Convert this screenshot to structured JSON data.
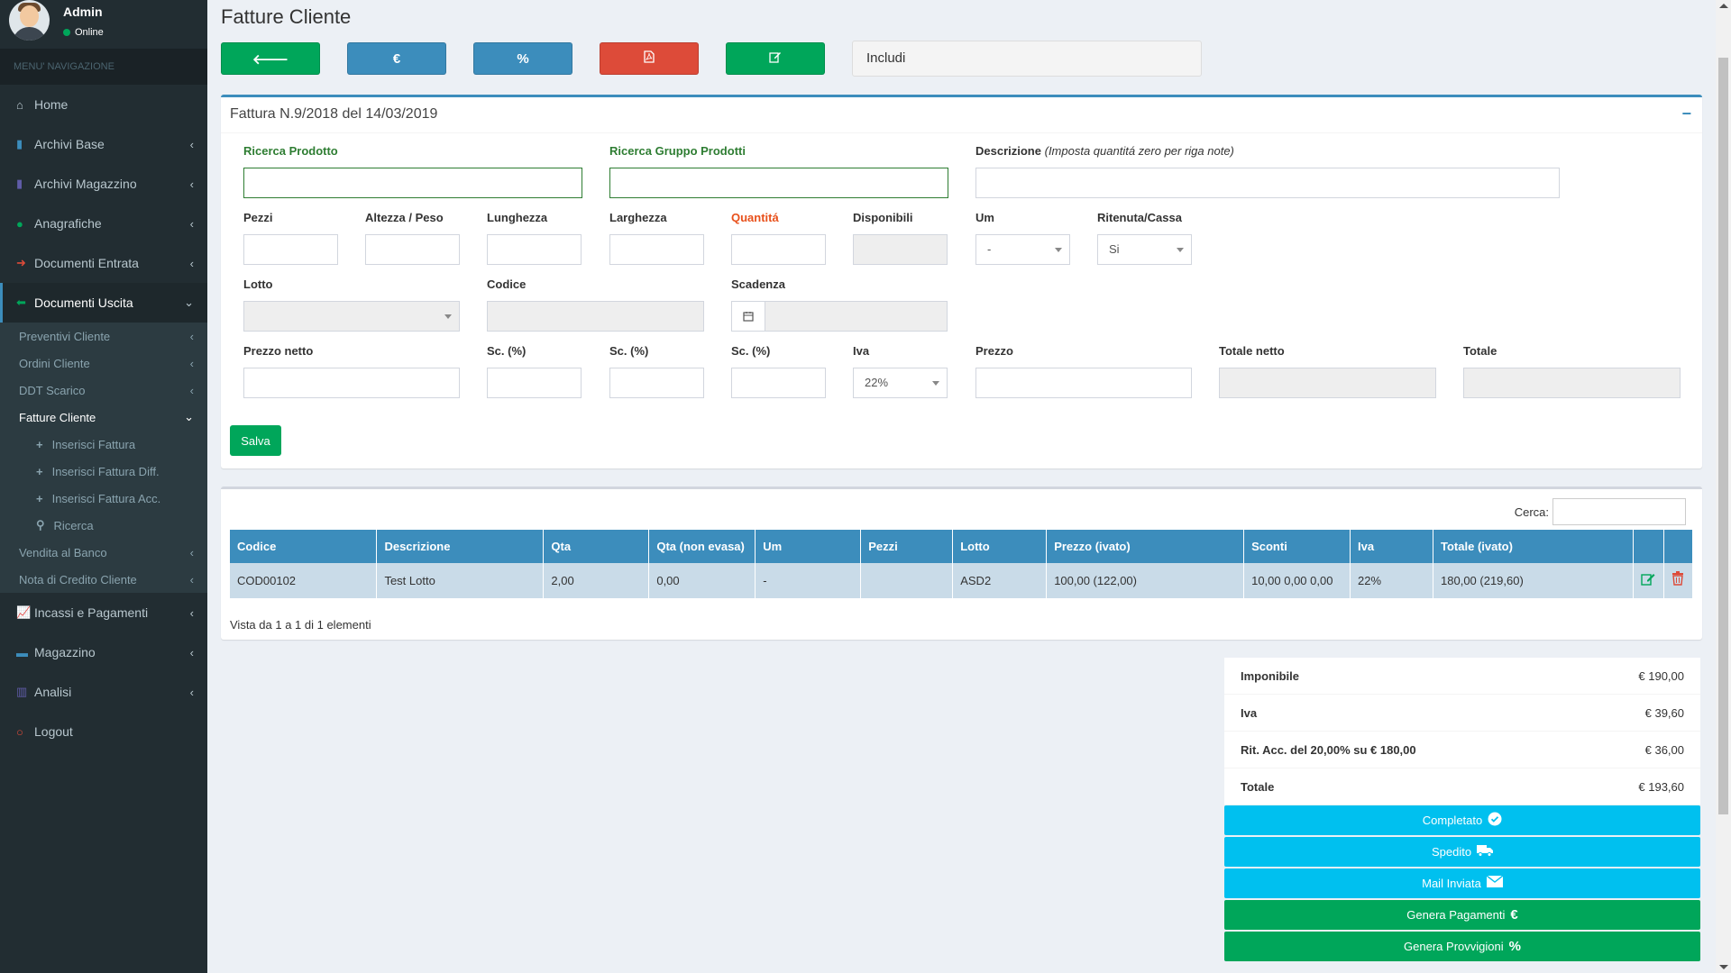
{
  "user": {
    "name": "Admin",
    "status": "Online"
  },
  "menu": {
    "header": "MENU' NAVIGAZIONE",
    "items": [
      {
        "label": "Home",
        "icon": "home-icon"
      },
      {
        "label": "Archivi Base",
        "icon": "book-icon"
      },
      {
        "label": "Archivi Magazzino",
        "icon": "archive-icon"
      },
      {
        "label": "Anagrafiche",
        "icon": "user-icon"
      },
      {
        "label": "Documenti Entrata",
        "icon": "arrow-right-icon"
      },
      {
        "label": "Documenti Uscita",
        "icon": "arrow-left-icon"
      },
      {
        "label": "Incassi e Pagamenti",
        "icon": "line-chart-icon"
      },
      {
        "label": "Magazzino",
        "icon": "truck-icon"
      },
      {
        "label": "Analisi",
        "icon": "bar-chart-icon"
      },
      {
        "label": "Logout",
        "icon": "power-icon"
      }
    ],
    "submenu": [
      "Preventivi Cliente",
      "Ordini Cliente",
      "DDT Scarico",
      "Fatture Cliente",
      "Vendita al Banco",
      "Nota di Credito Cliente"
    ],
    "subsubmenu": [
      "Inserisci Fattura",
      "Inserisci Fattura Diff.",
      "Inserisci Fattura Acc.",
      "Ricerca"
    ]
  },
  "page": {
    "title": "Fatture Cliente",
    "includi": "Includi"
  },
  "toolbar": {
    "back": "🡐",
    "euro": "€",
    "percent": "%"
  },
  "form": {
    "header": "Fattura N.9/2018 del 14/03/2019",
    "ricerca_prodotto": "Ricerca Prodotto",
    "ricerca_gruppo": "Ricerca Gruppo Prodotti",
    "descrizione": "Descrizione",
    "descrizione_note": "(Imposta quantitá zero per riga note)",
    "pezzi": "Pezzi",
    "altezza": "Altezza / Peso",
    "lunghezza": "Lunghezza",
    "larghezza": "Larghezza",
    "quantita": "Quantitá",
    "disponibili": "Disponibili",
    "um": "Um",
    "um_value": "-",
    "ritenuta": "Ritenuta/Cassa",
    "ritenuta_value": "Si",
    "lotto": "Lotto",
    "codice": "Codice",
    "scadenza": "Scadenza",
    "prezzo_netto": "Prezzo netto",
    "sc1": "Sc. (%)",
    "sc2": "Sc. (%)",
    "sc3": "Sc. (%)",
    "iva": "Iva",
    "iva_value": "22%",
    "prezzo": "Prezzo",
    "totale_netto": "Totale netto",
    "totale": "Totale",
    "salva": "Salva"
  },
  "table": {
    "search_label": "Cerca:",
    "columns": [
      "Codice",
      "Descrizione",
      "Qta",
      "Qta (non evasa)",
      "Um",
      "Pezzi",
      "Lotto",
      "Prezzo (ivato)",
      "Sconti",
      "Iva",
      "Totale (ivato)"
    ],
    "rows": [
      [
        "COD00102",
        "Test Lotto",
        "2,00",
        "0,00",
        "-",
        "",
        "ASD2",
        "100,00 (122,00)",
        "10,00 0,00 0,00",
        "22%",
        "180,00 (219,60)"
      ]
    ],
    "info": "Vista da 1 a 1 di 1 elementi"
  },
  "summary": [
    {
      "label": "Imponibile",
      "value": "€ 190,00"
    },
    {
      "label": "Iva",
      "value": "€ 39,60"
    },
    {
      "label": "Rit. Acc. del 20,00% su € 180,00",
      "value": "€ 36,00"
    },
    {
      "label": "Totale",
      "value": "€ 193,60"
    }
  ],
  "actions": [
    {
      "label": "Completato",
      "icon": "check-circle-icon",
      "color": "#00c0ef"
    },
    {
      "label": "Spedito",
      "icon": "truck-icon",
      "color": "#00c0ef"
    },
    {
      "label": "Mail Inviata",
      "icon": "envelope-icon",
      "color": "#00c0ef"
    },
    {
      "label": "Genera Pagamenti",
      "icon": "euro-icon",
      "color": "#00a65a"
    },
    {
      "label": "Genera Provvigioni",
      "icon": "percent-icon",
      "color": "#00a65a"
    }
  ]
}
